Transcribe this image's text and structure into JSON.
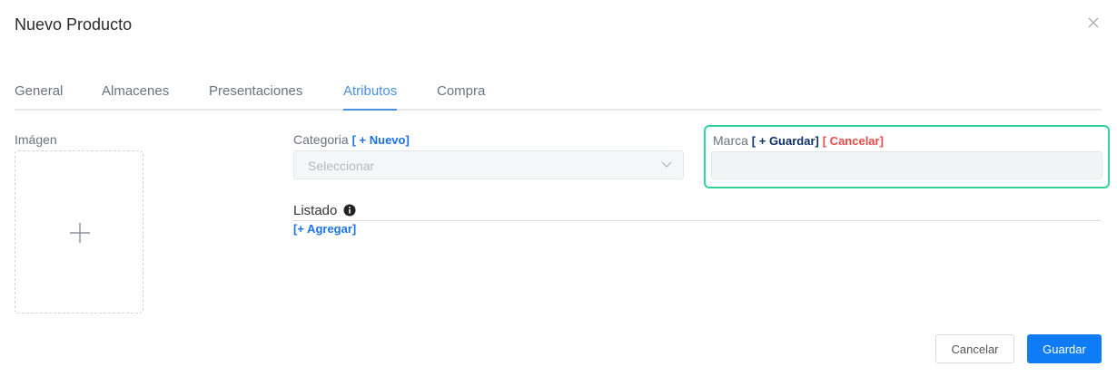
{
  "dialog": {
    "title": "Nuevo Producto",
    "close_icon": "close-icon"
  },
  "tabs": [
    {
      "label": "General",
      "active": false
    },
    {
      "label": "Almacenes",
      "active": false
    },
    {
      "label": "Presentaciones",
      "active": false
    },
    {
      "label": "Atributos",
      "active": true
    },
    {
      "label": "Compra",
      "active": false
    }
  ],
  "image": {
    "label": "Imágen",
    "icon": "plus-icon"
  },
  "categoria": {
    "label": "Categoria",
    "new_link": "[ + Nuevo]",
    "placeholder": "Seleccionar",
    "icon": "chevron-down-icon"
  },
  "marca": {
    "label": "Marca",
    "save_link": "[ + Guardar]",
    "cancel_link": "[ Cancelar]",
    "value": ""
  },
  "listado": {
    "label": "Listado",
    "info_icon": "info-icon",
    "add_link": "[+ Agregar]"
  },
  "footer": {
    "cancel_label": "Cancelar",
    "save_label": "Guardar"
  },
  "colors": {
    "accent": "#4a90e2",
    "primary_button": "#0f7bf5",
    "highlight_border": "#34d399",
    "cancel_link": "#e84a4a"
  }
}
